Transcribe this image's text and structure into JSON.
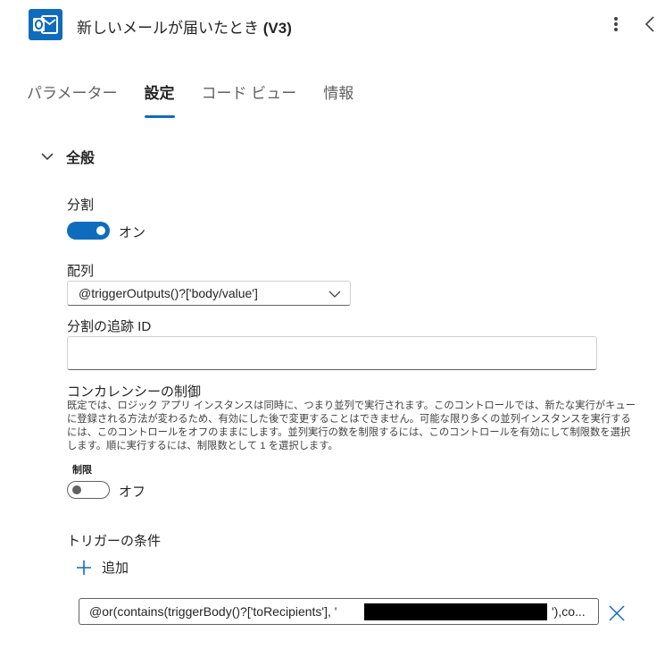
{
  "header": {
    "icon": "outlook-icon",
    "title_main": "新しいメールが届いたとき ",
    "title_version": "(V3)",
    "more_icon": "more-vertical-icon",
    "collapse_icon": "chevron-left-icon"
  },
  "tabs": [
    {
      "label": "パラメーター",
      "active": false
    },
    {
      "label": "設定",
      "active": true
    },
    {
      "label": "コード ビュー",
      "active": false
    },
    {
      "label": "情報",
      "active": false
    }
  ],
  "general": {
    "section_label": "全般",
    "split": {
      "label": "分割",
      "state": "オン"
    },
    "array": {
      "label": "配列",
      "value": "@triggerOutputs()?['body/value']"
    },
    "split_tracking_id": {
      "label": "分割の追跡 ID",
      "value": ""
    },
    "concurrency": {
      "label": "コンカレンシーの制御",
      "description": "既定では、ロジック アプリ インスタンスは同時に、つまり並列で実行されます。このコントロールでは、新たな実行がキューに登録される方法が変わるため、有効にした後で変更することはできません。可能な限り多くの並列インスタンスを実行するには、このコントロールをオフのままにします。並列実行の数を制限するには、このコントロールを有効にして制限数を選択します。順に実行するには、制限数として 1 を選択します。",
      "limit_label": "制限",
      "limit_state": "オフ"
    },
    "trigger_conditions": {
      "label": "トリガーの条件",
      "add_label": "追加",
      "condition_value": "@or(contains(triggerBody()?['toRecipients'], '",
      "condition_tail": "'),co..."
    }
  },
  "colors": {
    "accent": "#0f6cbd",
    "text": "#242424",
    "muted": "#616161"
  }
}
